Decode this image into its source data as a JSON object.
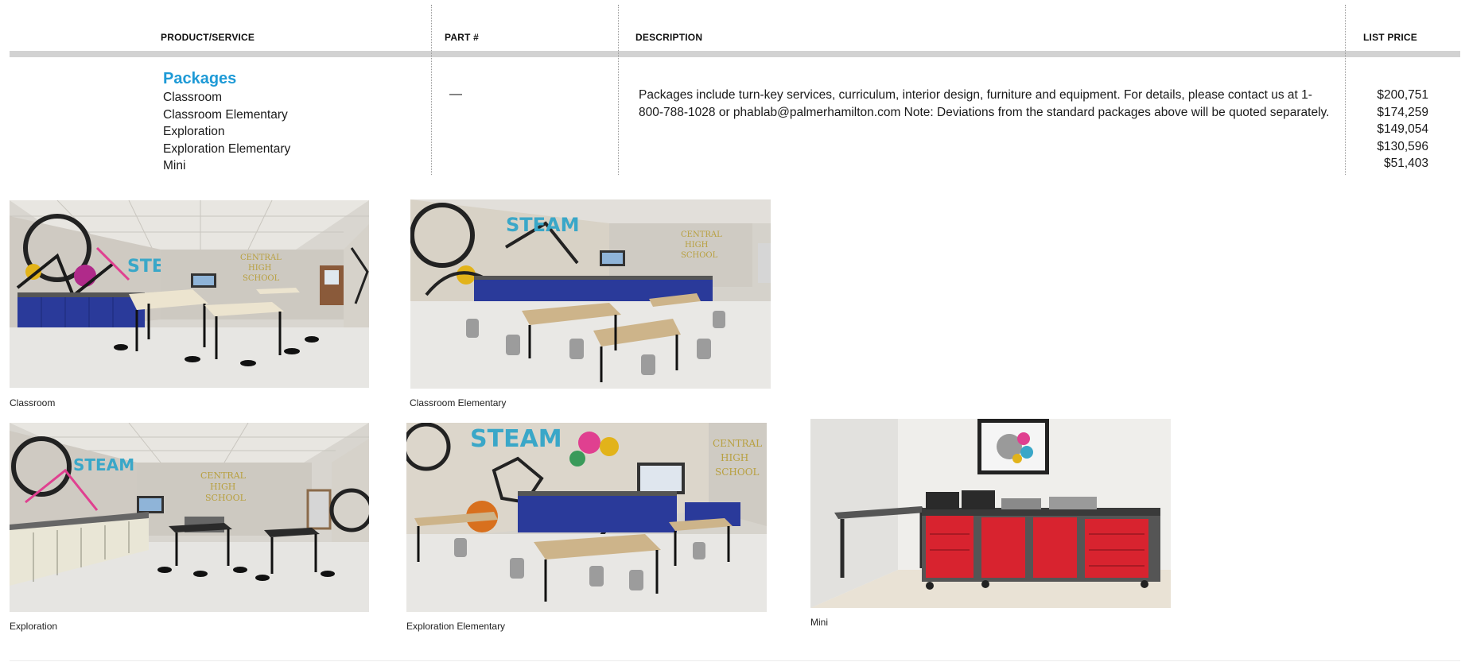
{
  "table": {
    "headers": {
      "product": "PRODUCT/SERVICE",
      "part": "PART #",
      "description": "DESCRIPTION",
      "price": "LIST PRICE"
    },
    "section_title": "Packages",
    "part_value": "—",
    "items": [
      "Classroom",
      "Classroom Elementary",
      "Exploration",
      "Exploration Elementary",
      "Mini"
    ],
    "description": "Packages include turn-key services, curriculum, interior design, furniture and equipment.  For details, please contact us at 1-800-788-1028 or phablab@palmerhamilton.com Note: Deviations from the standard packages above will be quoted separately.",
    "prices": [
      "$200,751",
      "$174,259",
      "$149,054",
      "$130,596",
      "$51,403"
    ]
  },
  "gallery": {
    "captions": [
      "Classroom",
      "Classroom Elementary",
      "Exploration",
      "Exploration Elementary",
      "Mini"
    ],
    "mural_text": [
      "STEAM",
      "CENTRAL",
      "HIGH",
      "SCHOOL"
    ]
  },
  "colors": {
    "accent": "#1e9ad6",
    "cabinet_blue": "#2a3a9a",
    "cabinet_red": "#d8232f"
  }
}
